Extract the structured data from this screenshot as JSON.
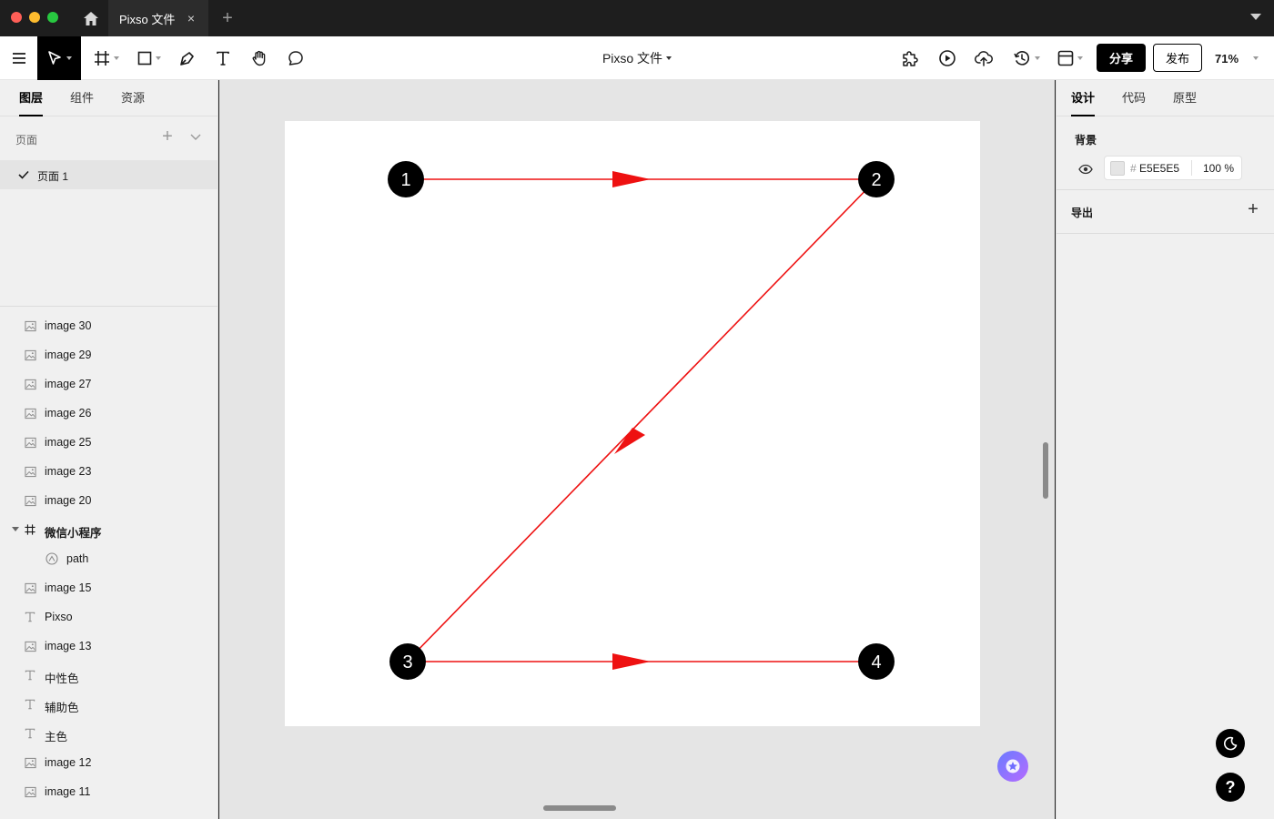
{
  "window": {
    "tab_title": "Pixso 文件"
  },
  "toolbar": {
    "doc_title": "Pixso 文件",
    "share_label": "分享",
    "publish_label": "发布",
    "zoom": "71%"
  },
  "left_panel": {
    "tabs": [
      "图层",
      "组件",
      "资源"
    ],
    "pages_label": "页面",
    "current_page": "页面 1",
    "layers": [
      {
        "name": "image 30",
        "type": "image",
        "indent": 0
      },
      {
        "name": "image 29",
        "type": "image",
        "indent": 0
      },
      {
        "name": "image 27",
        "type": "image",
        "indent": 0
      },
      {
        "name": "image 26",
        "type": "image",
        "indent": 0
      },
      {
        "name": "image 25",
        "type": "image",
        "indent": 0
      },
      {
        "name": "image 23",
        "type": "image",
        "indent": 0
      },
      {
        "name": "image 20",
        "type": "image",
        "indent": 0
      },
      {
        "name": "微信小程序",
        "type": "frame",
        "indent": 0
      },
      {
        "name": "path",
        "type": "vector",
        "indent": 1
      },
      {
        "name": "image 15",
        "type": "image",
        "indent": 0
      },
      {
        "name": "Pixso",
        "type": "text",
        "indent": 0
      },
      {
        "name": "image 13",
        "type": "image",
        "indent": 0
      },
      {
        "name": "中性色",
        "type": "text",
        "indent": 0
      },
      {
        "name": "辅助色",
        "type": "text",
        "indent": 0
      },
      {
        "name": "主色",
        "type": "text",
        "indent": 0
      },
      {
        "name": "image 12",
        "type": "image",
        "indent": 0
      },
      {
        "name": "image 11",
        "type": "image",
        "indent": 0
      }
    ]
  },
  "canvas": {
    "nodes": [
      "1",
      "2",
      "3",
      "4"
    ],
    "line_color": "#ee1111",
    "node_color": "#000000"
  },
  "right_panel": {
    "tabs": [
      "设计",
      "代码",
      "原型"
    ],
    "background_title": "背景",
    "bg_hex": "E5E5E5",
    "bg_hash": "#",
    "bg_opacity": "100 %",
    "export_title": "导出",
    "help_label": "?"
  }
}
